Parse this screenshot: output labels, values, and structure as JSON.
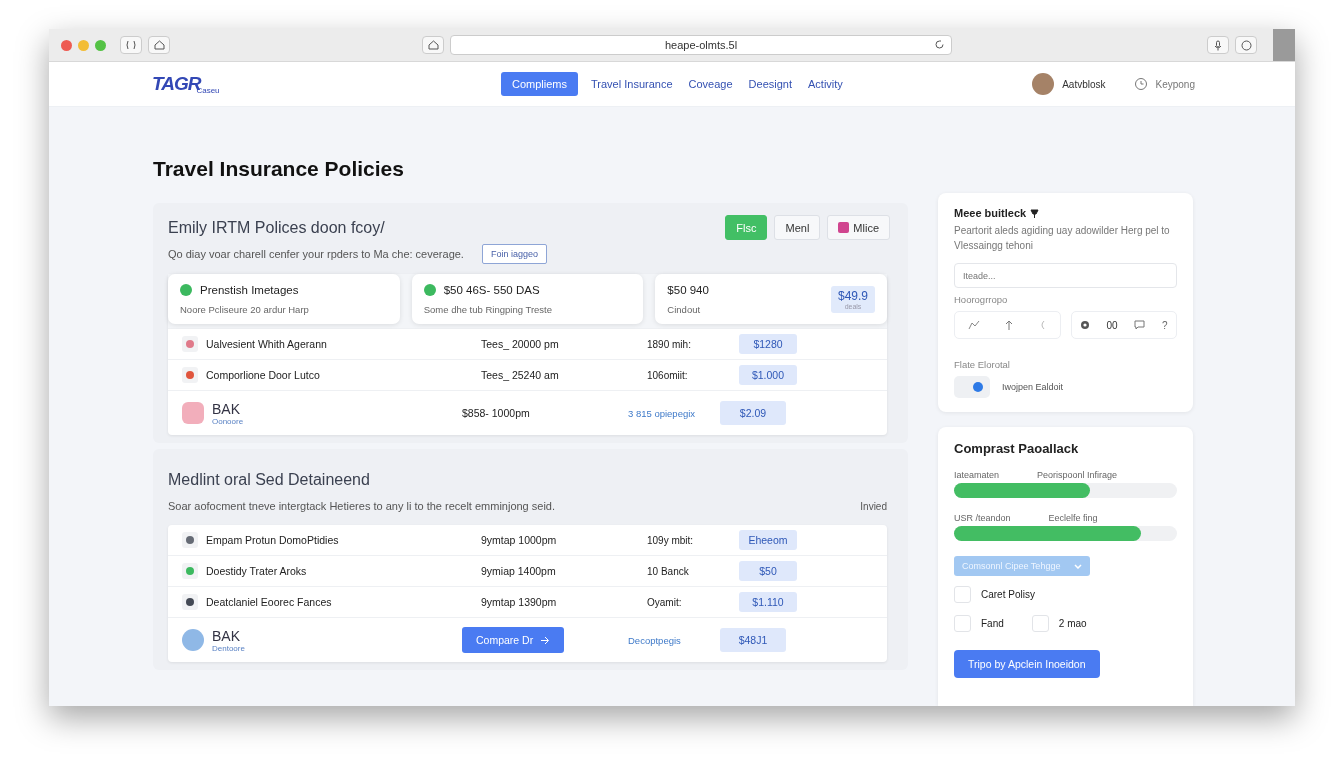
{
  "browser": {
    "url": "heape-olmts.5l"
  },
  "nav": {
    "logo": "TAGR",
    "logo_sub": "Caseu",
    "tabs": [
      {
        "label": "Compliems",
        "selected": true
      },
      {
        "label": "Travel Insurance",
        "selected": false
      },
      {
        "label": "Coveage",
        "selected": false
      },
      {
        "label": "Deesignt",
        "selected": false
      },
      {
        "label": "Activity",
        "selected": false
      }
    ],
    "user": "Aatvblosk",
    "help": "Keypong"
  },
  "page_title": "Travel Insurance Policies",
  "section_1": {
    "title": "Emily IRTM Polices doon fcoy/",
    "actions": [
      {
        "label": "Flsc",
        "kind": "primary"
      },
      {
        "label": "Menl",
        "kind": "plain"
      },
      {
        "label": "Mlice",
        "kind": "icon"
      }
    ],
    "description": "Qo diay voar charell cenfer your rpders to Ma che: ceverage.",
    "link": "Foin iaggeo",
    "cards": [
      {
        "title": "Prenstish Imetages",
        "subtitle": "Noore Pcliseure 20 ardur Harp",
        "color": "#3cb95f"
      },
      {
        "title": "$50 46S- 550 DAS",
        "subtitle": "Some dhe tub Ringping Treste",
        "color": "#3cb95f"
      },
      {
        "title": "$50 940",
        "subtitle": "Cindout",
        "price": "$49.9",
        "price_note": "deals"
      }
    ],
    "rows": [
      {
        "kind": "line",
        "name": "Ualvesient Whith Agerann",
        "time": "Tees_ 20000 pm",
        "note": "1890 mih:",
        "price": "$1280",
        "color": "#e07a8a"
      },
      {
        "kind": "line",
        "name": "Comporlione Door Lutco",
        "time": "Tees_ 25240 am",
        "note": "106omiit:",
        "price": "$1.000",
        "color": "#e0553d"
      },
      {
        "kind": "total",
        "name": "BAK",
        "sub": "Oonoore",
        "time": "$858- 1000pm",
        "link": "3 815 opiepegix",
        "price": "$2.09",
        "color": "#f2aebb"
      }
    ]
  },
  "section_2": {
    "title": "Medlint oral Sed Detaineend",
    "description": "Soar aofocment tneve intergtack Hetieres to any li to the recelt emminjong seid.",
    "aside": "Invied",
    "rows": [
      {
        "kind": "line",
        "name": "Empam Protun DomoPtidies",
        "time": "9ymtap 1000pm",
        "note": "109y mbit:",
        "price": "Eheeom",
        "color": "#666b75"
      },
      {
        "kind": "line",
        "name": "Doestidy Trater Aroks",
        "time": "9ymiap 1400pm",
        "note": "10 Banck",
        "price": "$50",
        "color": "#3cb95f"
      },
      {
        "kind": "line",
        "name": "Deatclaniel Eoorec Fances",
        "time": "9ymtap 1390pm",
        "note": "Oyamit:",
        "price": "$1.110",
        "color": "#444a55"
      },
      {
        "kind": "total",
        "name": "BAK",
        "sub": "Dentoore",
        "button": "Compare Dr",
        "link": "Decoptpegis",
        "price": "$48J1",
        "color": "#8fb8e6"
      }
    ]
  },
  "feedback": {
    "title": "Meee buitleck",
    "description": "Peartorit aleds agiding uay adowilder Herg pel to Vlessaingg tehoni",
    "input_placeholder": "Iteade...",
    "group_label": "Hoorogrropo",
    "counter": "00",
    "help_glyph": "?",
    "toggle_label": "Flate Elorotal",
    "toggle_on": true,
    "toggle_text": "Iwojpen Ealdoit"
  },
  "compare": {
    "title": "Comprast Paoallack",
    "bars": [
      {
        "label": "Iateamaten",
        "detail": "Peorispoonl Infirage",
        "level": 0.61
      },
      {
        "label": "USR /teandon",
        "detail": "Eeclelfe fing",
        "level": 0.84
      }
    ],
    "dropdown": "Comsonnl Cipee Tehgge",
    "checks": [
      {
        "label": "Caret Polisy",
        "checked": false
      },
      {
        "label": "Fand",
        "checked": false
      },
      {
        "label": "2 mao",
        "checked": false
      }
    ],
    "button": "Tripo by Apclein Inoeidon"
  }
}
